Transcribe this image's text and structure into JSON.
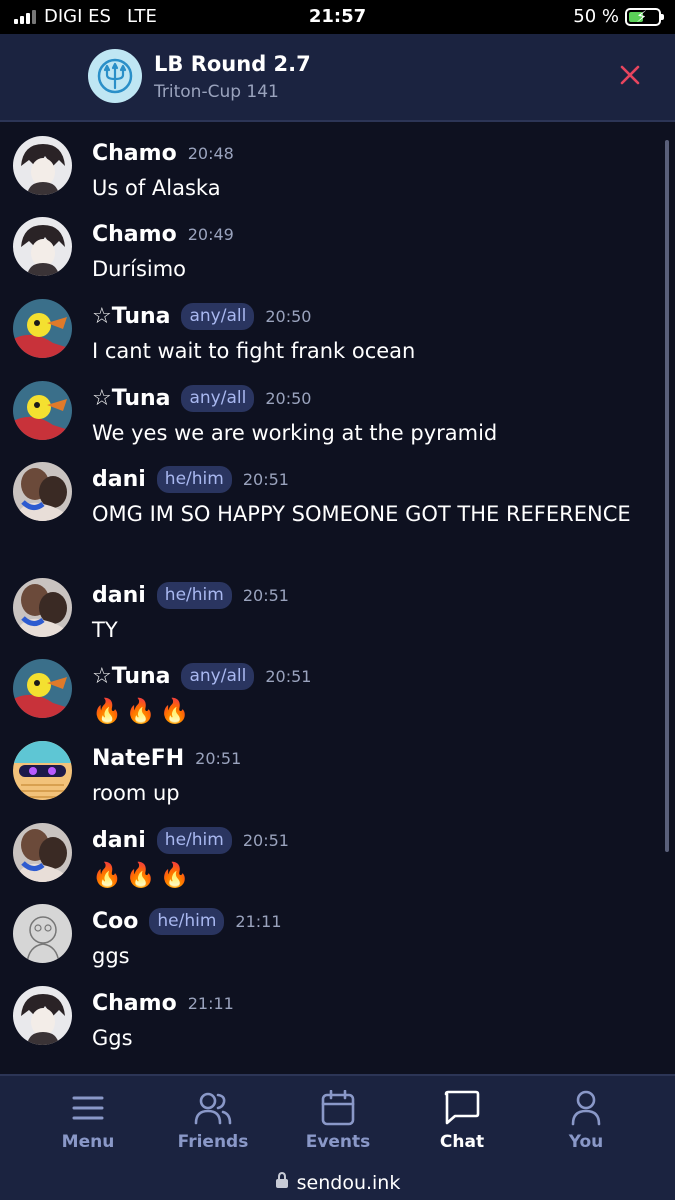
{
  "status_bar": {
    "carrier": "DIGI ES",
    "network": "LTE",
    "time": "21:57",
    "battery": "50 %",
    "battery_level": 0.5
  },
  "header": {
    "title": "LB Round 2.7",
    "subtitle": "Triton-Cup 141",
    "logo_icon": "trident-icon",
    "close_icon": "close-icon"
  },
  "messages": [
    {
      "name": "Chamo",
      "pronoun": "",
      "time": "20:48",
      "text": "Us of Alaska"
    },
    {
      "name": "Chamo",
      "pronoun": "",
      "time": "20:49",
      "text": "Durísimo"
    },
    {
      "name": "☆Tuna",
      "pronoun": "any/all",
      "time": "20:50",
      "text": "I cant wait to fight frank ocean"
    },
    {
      "name": "☆Tuna",
      "pronoun": "any/all",
      "time": "20:50",
      "text": "We yes we are working at the pyramid"
    },
    {
      "name": "dani",
      "pronoun": "he/him",
      "time": "20:51",
      "text": "OMG IM SO HAPPY SOMEONE GOT THE REFERENCE"
    },
    {
      "name": "dani",
      "pronoun": "he/him",
      "time": "20:51",
      "text": "TY"
    },
    {
      "name": "☆Tuna",
      "pronoun": "any/all",
      "time": "20:51",
      "text": "🔥🔥🔥"
    },
    {
      "name": "NateFH",
      "pronoun": "",
      "time": "20:51",
      "text": "room up"
    },
    {
      "name": "dani",
      "pronoun": "he/him",
      "time": "20:51",
      "text": "🔥🔥🔥"
    },
    {
      "name": "Coo",
      "pronoun": "he/him",
      "time": "21:11",
      "text": "ggs"
    },
    {
      "name": "Chamo",
      "pronoun": "",
      "time": "21:11",
      "text": "Ggs"
    }
  ],
  "nav": {
    "items": [
      {
        "label": "Menu",
        "icon": "menu-icon"
      },
      {
        "label": "Friends",
        "icon": "friends-icon"
      },
      {
        "label": "Events",
        "icon": "calendar-icon"
      },
      {
        "label": "Chat",
        "icon": "chat-icon"
      },
      {
        "label": "You",
        "icon": "user-icon"
      }
    ],
    "active": "Chat"
  },
  "url_bar": {
    "url": "sendou.ink",
    "icon": "lock-icon"
  },
  "colors": {
    "background": "#0e1120",
    "header": "#1b2340",
    "badge_bg": "#2a3560",
    "close": "#e8455e"
  }
}
